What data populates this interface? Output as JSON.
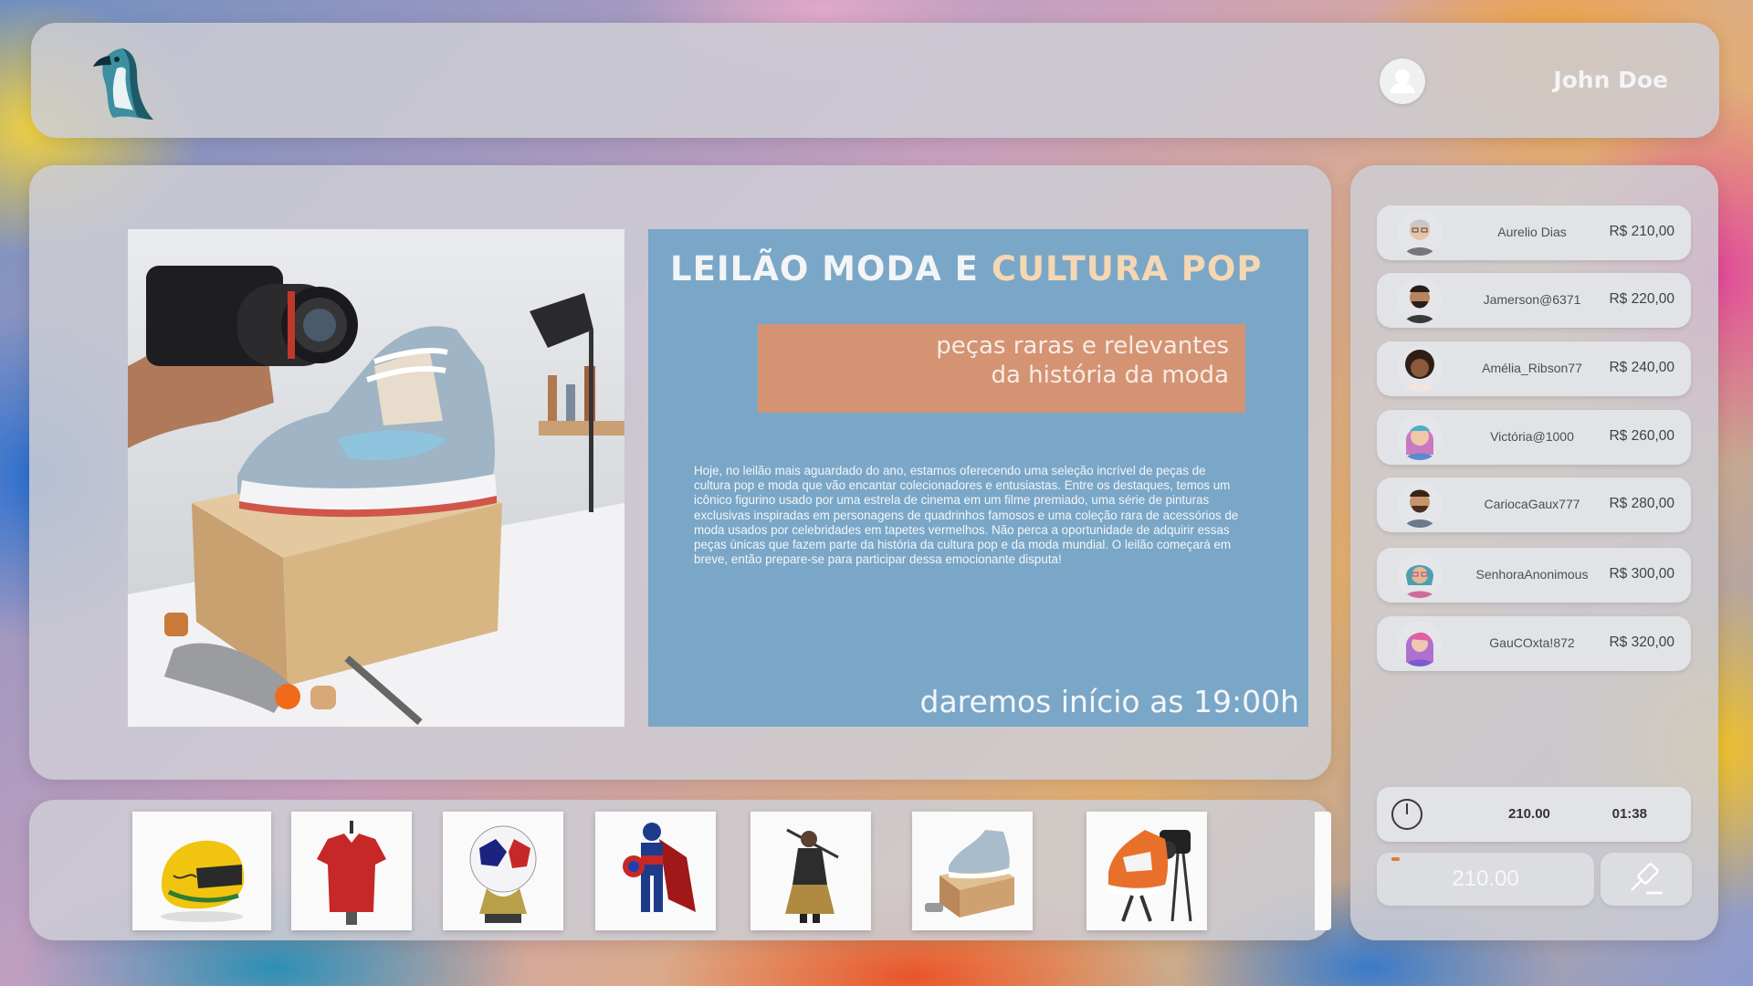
{
  "header": {
    "logo_icon": "penguin-logo-icon",
    "user_icon": "user-avatar-icon",
    "user_name": "John Doe"
  },
  "hero": {
    "image": "sneaker-photoshoot-image",
    "title_main": "LEILÃO MODA E ",
    "title_accent": "CULTURA POP",
    "tagline_line1": "peças raras e relevantes",
    "tagline_line2": "da história da moda",
    "description": "Hoje, no leilão mais aguardado do ano, estamos oferecendo uma seleção incrível de peças de cultura pop e moda que vão encantar colecionadores e entusiastas. Entre os destaques, temos um icônico figurino usado por uma estrela de cinema em um filme premiado, uma série de pinturas exclusivas inspiradas em personagens de quadrinhos famosos e uma coleção rara de acessórios de moda usados por celebridades em tapetes vermelhos. Não perca a oportunidade de adquirir essas peças únicas que fazem parte da história da cultura pop e da moda mundial. O leilão começará em breve, então prepare-se para participar dessa emocionante disputa!",
    "start_time": "daremos início as 19:00h",
    "colors": {
      "card": "#7aa7c7",
      "tagline_box": "#d49373",
      "accent": "#f5d7b3"
    }
  },
  "thumbnails": [
    {
      "name": "helmet-thumbnail"
    },
    {
      "name": "red-jersey-thumbnail"
    },
    {
      "name": "ball-trophy-thumbnail"
    },
    {
      "name": "captain-figure-thumbnail"
    },
    {
      "name": "warrior-figure-thumbnail"
    },
    {
      "name": "sneaker-box-thumbnail"
    },
    {
      "name": "sneaker-camera-thumbnail"
    }
  ],
  "bids": [
    {
      "name": "Aurelio Dias",
      "amount": "R$ 210,00",
      "avatar_color": "#d8c8b0"
    },
    {
      "name": "Jamerson@6371",
      "amount": "R$ 220,00",
      "avatar_color": "#4a3a30"
    },
    {
      "name": "Amélia_Ribson77",
      "amount": "R$ 240,00",
      "avatar_color": "#3a2a22"
    },
    {
      "name": "Victória@1000",
      "amount": "R$ 260,00",
      "avatar_color": "#c87ac0"
    },
    {
      "name": "CariocaGaux777",
      "amount": "R$ 280,00",
      "avatar_color": "#6a4a38"
    },
    {
      "name": "SenhoraAnonimous",
      "amount": "R$ 300,00",
      "avatar_color": "#4aa0b0"
    },
    {
      "name": "GauCOxta!872",
      "amount": "R$ 320,00",
      "avatar_color": "#b070d0"
    }
  ],
  "status": {
    "clock_icon": "clock-icon",
    "current_value": "210.00",
    "timer": "01:38"
  },
  "bid_input": {
    "placeholder": "210.00"
  },
  "bid_button": {
    "icon": "gavel-icon"
  }
}
